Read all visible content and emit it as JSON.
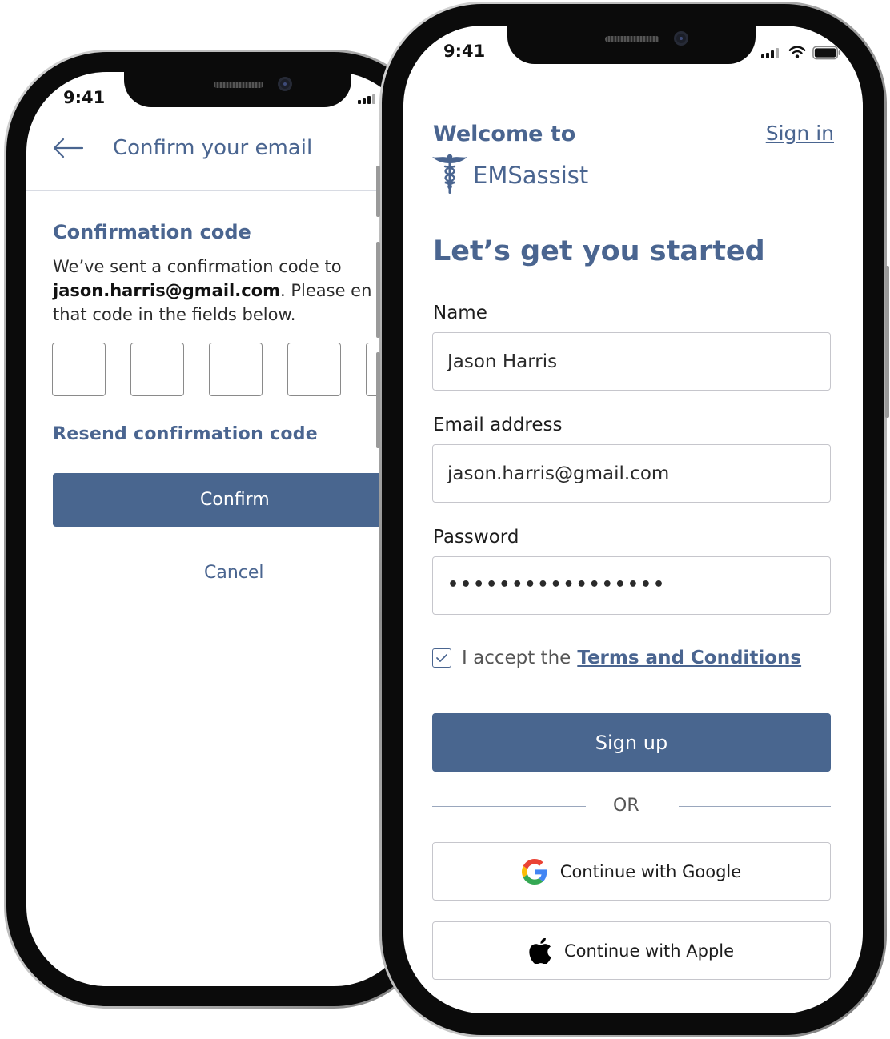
{
  "status_bar": {
    "time": "9:41"
  },
  "confirm_screen": {
    "title": "Confirm your email",
    "heading": "Confirmation code",
    "message_prefix": "We’ve sent a confirmation code to",
    "email": "jason.harris@gmail.com",
    "message_suffix": ". Please en",
    "message_line3": "that code in the fields below.",
    "resend_label": "Resend confirmation code",
    "confirm_label": "Confirm",
    "cancel_label": "Cancel"
  },
  "signup_screen": {
    "welcome": "Welcome to",
    "signin_link": "Sign in",
    "brand": "EMSassist",
    "heading": "Let’s get you started",
    "name_label": "Name",
    "name_value": "Jason Harris",
    "email_label": "Email address",
    "email_value": "jason.harris@gmail.com",
    "password_label": "Password",
    "password_value": "•••••••••••••••••",
    "terms_prefix": "I accept the",
    "terms_link": "Terms and Conditions",
    "terms_checked": true,
    "signup_label": "Sign up",
    "or_label": "OR",
    "google_label": "Continue with Google",
    "apple_label": "Continue with Apple"
  },
  "colors": {
    "brand": "#4a6590",
    "button": "#49668f",
    "border": "#c6c6cc"
  },
  "icons": [
    "back-arrow-icon",
    "signal-icon",
    "wifi-icon",
    "battery-icon",
    "caduceus-logo-icon",
    "check-icon",
    "google-icon",
    "apple-icon"
  ]
}
